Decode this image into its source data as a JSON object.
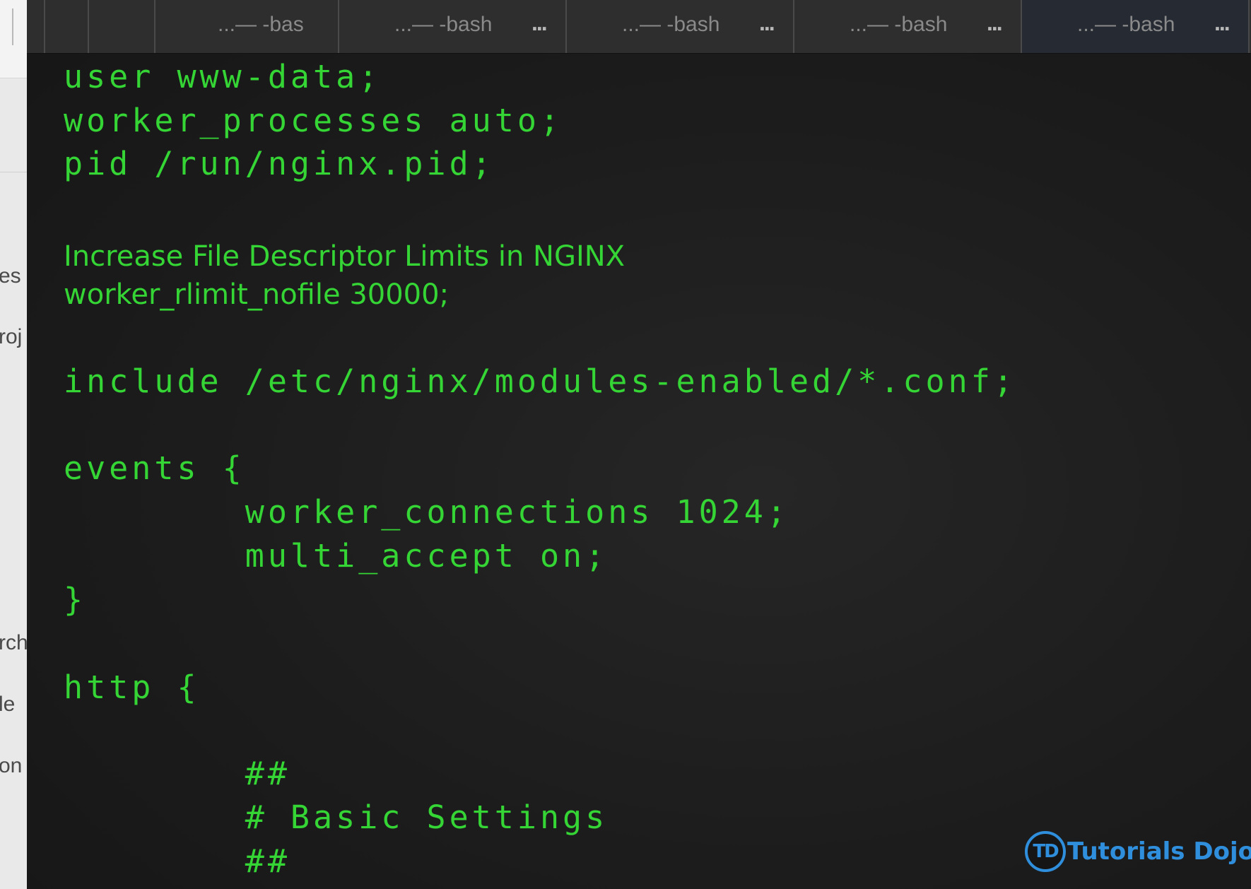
{
  "left_window": {
    "fragments": [
      "es",
      "roj",
      "rch",
      "le",
      "on"
    ]
  },
  "tabs": [
    {
      "label": "...— -bas",
      "more": "..."
    },
    {
      "label": "...— -bash",
      "more": "..."
    },
    {
      "label": "...— -bash",
      "more": "..."
    },
    {
      "label": "...— -bash",
      "more": "..."
    },
    {
      "label": "...— -bash",
      "more": "..."
    }
  ],
  "code": {
    "line1": "user www-data;",
    "line2": "worker_processes auto;",
    "line3": "pid /run/nginx.pid;",
    "note_title": "Increase File Descriptor Limits in NGINX",
    "note_line": "worker_rlimit_nofile 30000;",
    "line_include": "include /etc/nginx/modules-enabled/*.conf;",
    "line_events": "events {",
    "line_worker_conn": "        worker_connections 1024;",
    "line_multi_accept": "        multi_accept on;",
    "line_close": "}",
    "line_http": "http {",
    "line_hash1": "        ##",
    "line_basic": "        # Basic Settings",
    "line_hash2": "        ##"
  },
  "logo": {
    "badge": "TD",
    "text": "Tutorials Dojo",
    "color": "#2f8fdd"
  },
  "colors": {
    "code_text": "#35d535",
    "terminal_bg": "#1c1c1c",
    "tabbar_bg": "#2e2e2e"
  }
}
